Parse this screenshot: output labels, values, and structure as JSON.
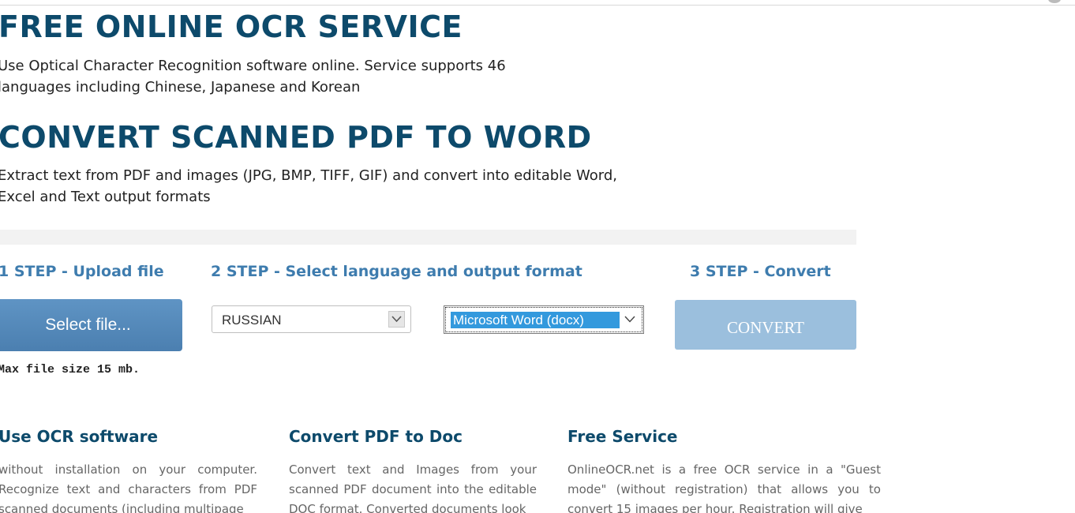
{
  "hero": {
    "title": "FREE ONLINE OCR SERVICE",
    "lead": "Use Optical Character Recognition software online. Service supports 46 languages including Chinese, Japanese and Korean"
  },
  "convert_section": {
    "title": "CONVERT SCANNED PDF TO WORD",
    "lead": "Extract text from PDF and images (JPG, BMP, TIFF, GIF) and convert into editable Word, Excel and Text output formats"
  },
  "steps": {
    "step1_title": "1 STEP - Upload file",
    "step2_title": "2 STEP - Select language and output format",
    "step3_title": "3 STEP - Convert"
  },
  "upload": {
    "select_file_label": "Select file...",
    "max_size_note": "Max file size 15 mb."
  },
  "language_select": {
    "value": "RUSSIAN"
  },
  "format_select": {
    "value": "Microsoft Word (docx)"
  },
  "convert_button": {
    "label": "CONVERT"
  },
  "features": [
    {
      "title": "Use OCR software",
      "text": "without installation on your computer. Recognize text and characters from PDF scanned documents (including multipage"
    },
    {
      "title": "Convert PDF to Doc",
      "text": "Convert text and Images from your scanned PDF document into the editable DOC format. Converted documents look"
    },
    {
      "title": "Free Service",
      "text": "OnlineOCR.net is a free OCR service in a \"Guest mode\" (without registration) that allows you to convert 15 images per hour. Registration will give"
    }
  ],
  "colors": {
    "heading": "#0d4a6b",
    "step_title": "#3e7cae",
    "select_button": "#5688ba",
    "convert_button": "#9bbfdd",
    "selection_highlight": "#3399dd"
  },
  "icons": {
    "lang_dropdown": "chevron-down-icon",
    "format_dropdown": "chevron-down-icon"
  }
}
